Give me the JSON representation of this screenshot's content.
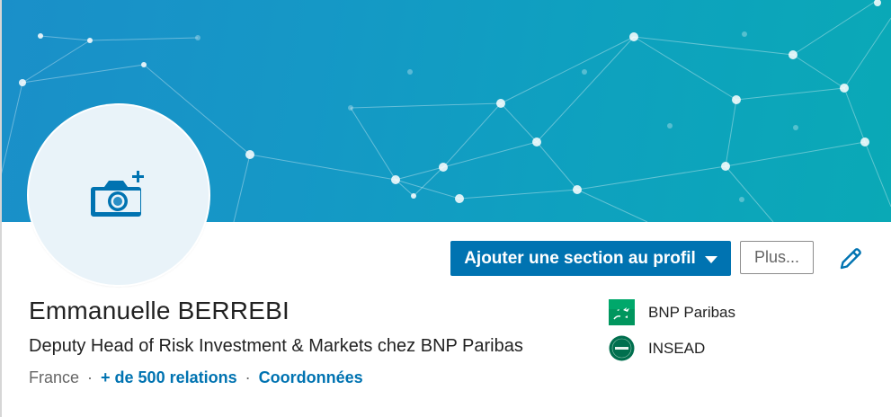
{
  "profile": {
    "name": "Emmanuelle BERREBI",
    "headline": "Deputy Head of Risk Investment & Markets chez BNP Paribas",
    "location": "France",
    "separator": "·",
    "connections_link": "+ de 500 relations",
    "contact_link": "Coordonnées"
  },
  "actions": {
    "add_section_label": "Ajouter une section au profil",
    "more_label": "Plus..."
  },
  "affiliations": [
    {
      "label": "BNP Paribas",
      "icon": "bnp-paribas-logo"
    },
    {
      "label": "INSEAD",
      "icon": "insead-logo"
    }
  ],
  "icons": {
    "avatar": "camera-plus-icon",
    "edit": "pencil-icon",
    "dropdown": "caret-down-icon"
  },
  "colors": {
    "primary": "#0073b1",
    "banner_start": "#1a8fc9",
    "banner_end": "#0aa9b6",
    "avatar_bg": "#e9f3f9",
    "bnp_green": "#00965e",
    "insead_green": "#006f4e"
  }
}
